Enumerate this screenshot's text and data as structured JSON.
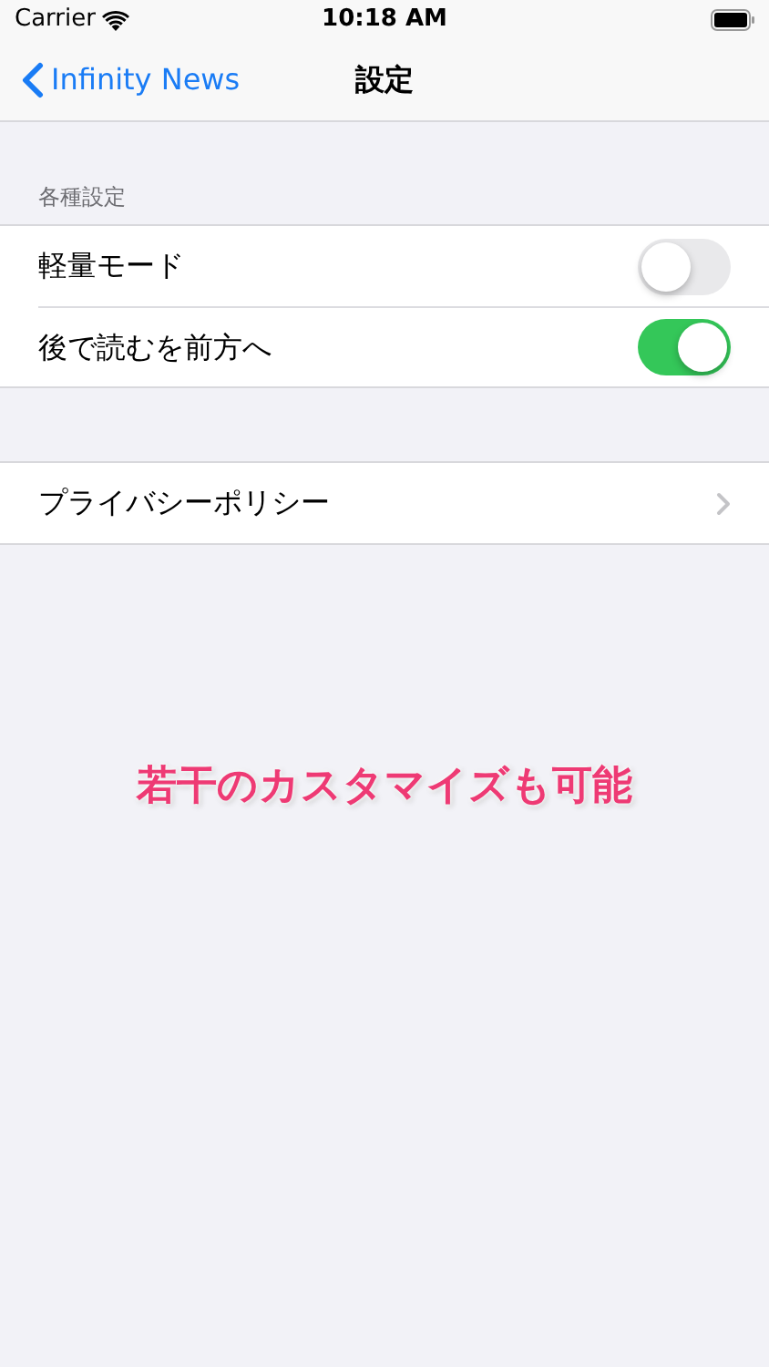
{
  "status_bar": {
    "carrier": "Carrier",
    "time": "10:18 AM"
  },
  "nav_bar": {
    "back": "Infinity News",
    "title": "設定"
  },
  "sections": [
    {
      "header": "各種設定",
      "rows": [
        {
          "kind": "toggle",
          "label": "軽量モード",
          "on": false
        },
        {
          "kind": "toggle",
          "label": "後で読むを前方へ",
          "on": true
        }
      ]
    },
    {
      "rows": [
        {
          "kind": "link",
          "label": "プライバシーポリシー"
        }
      ]
    }
  ],
  "caption": "若干のカスタマイズも可能"
}
